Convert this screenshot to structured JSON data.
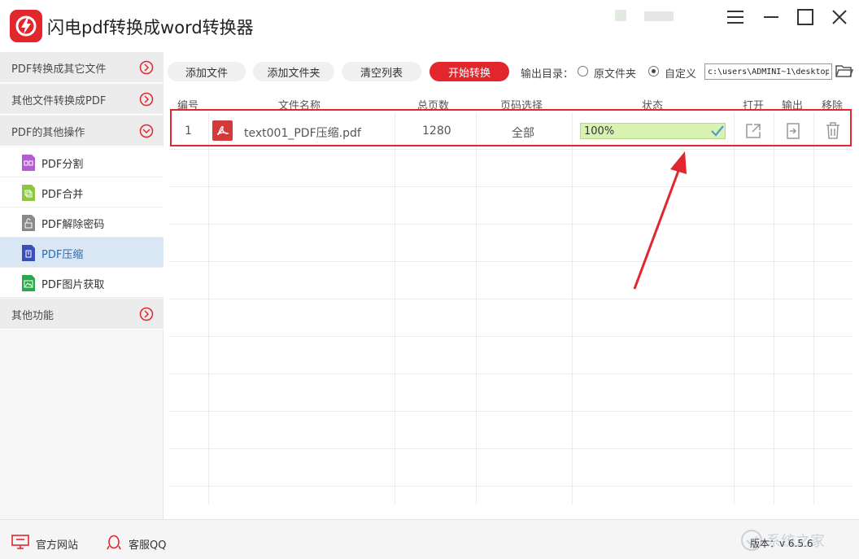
{
  "app": {
    "title": "闪电pdf转换成word转换器"
  },
  "sidebar": {
    "categories": [
      {
        "label": "PDF转换成其它文件",
        "state": "collapsed"
      },
      {
        "label": "其他文件转换成PDF",
        "state": "collapsed"
      },
      {
        "label": "PDF的其他操作",
        "state": "expanded"
      },
      {
        "label": "其他功能",
        "state": "collapsed"
      }
    ],
    "sub_items": [
      {
        "label": "PDF分割",
        "icon": "pdf-split-icon",
        "color": "#b35bd1"
      },
      {
        "label": "PDF合并",
        "icon": "pdf-merge-icon",
        "color": "#8dc63f"
      },
      {
        "label": "PDF解除密码",
        "icon": "pdf-unlock-icon",
        "color": "#8a8a8a"
      },
      {
        "label": "PDF压缩",
        "icon": "pdf-compress-icon",
        "color": "#3b4fb8",
        "active": true
      },
      {
        "label": "PDF图片获取",
        "icon": "pdf-image-icon",
        "color": "#2aa84a"
      }
    ]
  },
  "toolbar": {
    "add_file": "添加文件",
    "add_folder": "添加文件夹",
    "clear_list": "清空列表",
    "start": "开始转换",
    "output_label": "输出目录：",
    "option_original": "原文件夹",
    "option_custom": "自定义",
    "selected_option": "自定义",
    "output_path": "c:\\users\\ADMINI~1\\desktop"
  },
  "table": {
    "headers": [
      "编号",
      "文件名称",
      "总页数",
      "页码选择",
      "状态",
      "打开",
      "输出",
      "移除"
    ],
    "rows": [
      {
        "index": "1",
        "filename": "text001_PDF压缩.pdf",
        "pages": "1280",
        "page_selection": "全部",
        "status": "100%"
      }
    ]
  },
  "footer": {
    "website": "官方网站",
    "qq": "客服QQ",
    "version": "版本：v 6.5.6"
  },
  "colors": {
    "accent": "#e2262e",
    "progress_fill": "#d7f2b1",
    "active_item": "#d9e6f4",
    "check": "#4a9be0"
  },
  "watermark": {
    "text": "系统之家"
  }
}
